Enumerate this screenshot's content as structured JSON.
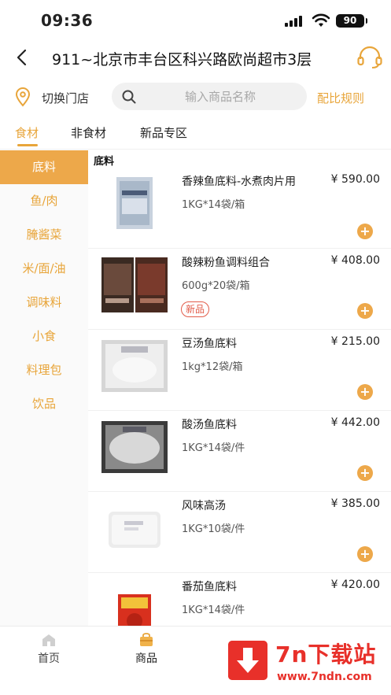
{
  "status_bar": {
    "time": "09:36",
    "battery": "90"
  },
  "header": {
    "title": "911~北京市丰台区科兴路欧尚超市3层"
  },
  "store_bar": {
    "switch_store": "切换门店",
    "search_placeholder": "输入商品名称",
    "rules": "配比规则"
  },
  "tabs": [
    {
      "label": "食材",
      "active": true
    },
    {
      "label": "非食材",
      "active": false
    },
    {
      "label": "新品专区",
      "active": false
    }
  ],
  "sidebar": [
    {
      "label": "底料",
      "active": true
    },
    {
      "label": "鱼/肉"
    },
    {
      "label": "腌酱菜"
    },
    {
      "label": "米/面/油"
    },
    {
      "label": "调味料"
    },
    {
      "label": "小食"
    },
    {
      "label": "料理包"
    },
    {
      "label": "饮品"
    }
  ],
  "section_title": "底料",
  "products": [
    {
      "name": "香辣鱼底料-水煮肉片用",
      "price": "¥ 590.00",
      "spec": "1KG*14袋/箱"
    },
    {
      "name": "酸辣粉鱼调料组合",
      "price": "¥ 408.00",
      "spec": "600g*20袋/箱",
      "badge": "新品"
    },
    {
      "name": "豆汤鱼底料",
      "price": "¥ 215.00",
      "spec": "1kg*12袋/箱"
    },
    {
      "name": "酸汤鱼底料",
      "price": "¥ 442.00",
      "spec": "1KG*14袋/件"
    },
    {
      "name": "风味高汤",
      "price": "¥ 385.00",
      "spec": "1KG*10袋/件"
    },
    {
      "name": "番茄鱼底料",
      "price": "¥ 420.00",
      "spec": "1KG*14袋/件"
    }
  ],
  "add_symbol": "+",
  "bottom_nav": [
    {
      "label": "首页",
      "icon": "home-icon"
    },
    {
      "label": "商品",
      "icon": "shop-bag-icon",
      "active": true
    }
  ],
  "watermark": {
    "text": "7n下载站",
    "url": "www.7ndn.com"
  },
  "colors": {
    "accent": "#e8a53a",
    "sidebar_active": "#eda84a",
    "badge": "#e25c4a"
  }
}
